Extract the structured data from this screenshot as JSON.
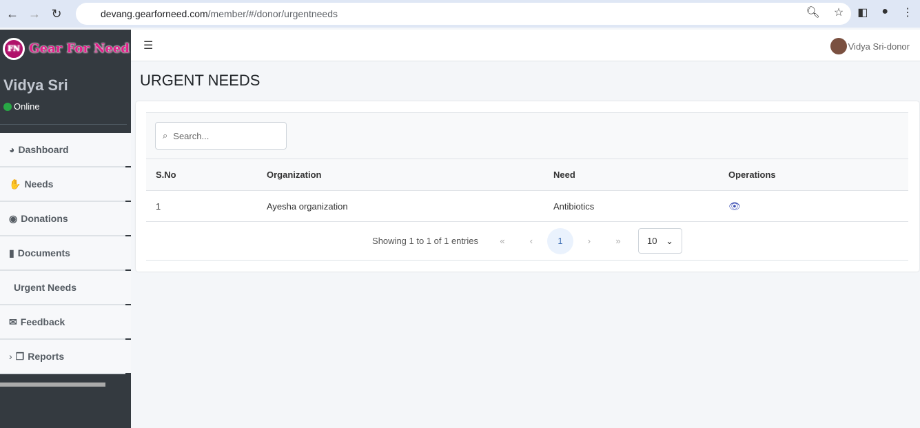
{
  "browser": {
    "url_host": "devang.gearforneed.com",
    "url_path": "/member/#/donor/urgentneeds"
  },
  "sidebar": {
    "logo_text": "Gear For Need",
    "logo_badge": "FN",
    "user_name": "Vidya Sri",
    "status": "Online",
    "items": [
      {
        "label": "Dashboard",
        "icon": "◕"
      },
      {
        "label": "Needs",
        "icon": "✋"
      },
      {
        "label": "Donations",
        "icon": "◉"
      },
      {
        "label": "Documents",
        "icon": "▮"
      },
      {
        "label": "Urgent Needs",
        "icon": ""
      },
      {
        "label": "Feedback",
        "icon": "✉"
      },
      {
        "label": "Reports",
        "icon": "❐"
      }
    ]
  },
  "topbar": {
    "user": "Vidya Sri-donor"
  },
  "page": {
    "title": "URGENT NEEDS",
    "search_placeholder": "Search...",
    "columns": [
      "S.No",
      "Organization",
      "Need",
      "Operations"
    ],
    "rows": [
      {
        "sno": "1",
        "org": "Ayesha organization",
        "need": "Antibiotics"
      }
    ],
    "showing": "Showing 1 to 1 of 1 entries",
    "page": "1",
    "page_size": "10"
  }
}
